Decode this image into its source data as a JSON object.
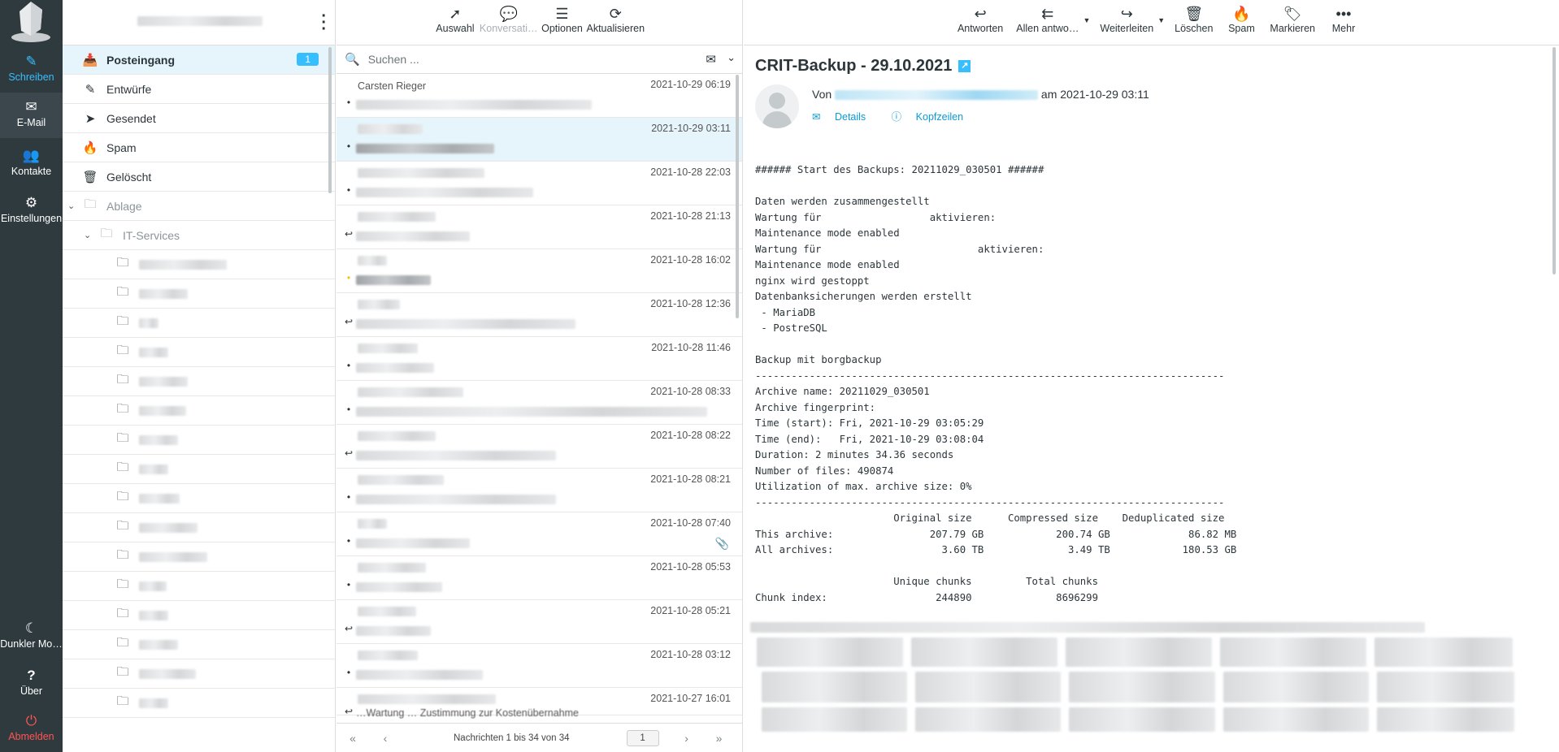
{
  "taskmenu": {
    "compose": "Schreiben",
    "mail": "E-Mail",
    "contacts": "Kontakte",
    "settings": "Einstellungen",
    "darkmode": "Dunkler Mo…",
    "about": "Über",
    "logout": "Abmelden"
  },
  "folders": {
    "inbox": "Posteingang",
    "inbox_unread": "1",
    "drafts": "Entwürfe",
    "sent": "Gesendet",
    "spam": "Spam",
    "trash": "Gelöscht",
    "archive": "Ablage",
    "itservices": "IT-Services"
  },
  "listtoolbar": {
    "select": "Auswahl",
    "threads": "Konversati…",
    "options": "Optionen",
    "refresh": "Aktualisieren"
  },
  "search": {
    "placeholder": "Suchen ..."
  },
  "messages": [
    {
      "from": "Carsten Rieger",
      "date": "2021-10-29 06:19"
    },
    {
      "date": "2021-10-29 03:11"
    },
    {
      "date": "2021-10-28 22:03"
    },
    {
      "date": "2021-10-28 21:13"
    },
    {
      "date": "2021-10-28 16:02"
    },
    {
      "date": "2021-10-28 12:36"
    },
    {
      "date": "2021-10-28 11:46"
    },
    {
      "date": "2021-10-28 08:33"
    },
    {
      "date": "2021-10-28 08:22"
    },
    {
      "date": "2021-10-28 08:21"
    },
    {
      "date": "2021-10-28 07:40"
    },
    {
      "date": "2021-10-28 05:53"
    },
    {
      "date": "2021-10-28 05:21"
    },
    {
      "date": "2021-10-28 03:12"
    },
    {
      "date": "2021-10-27 16:01",
      "subject": "…Wartung …  Zustimmung zur Kostenübernahme"
    }
  ],
  "pager": {
    "count": "Nachrichten 1 bis 34 von 34",
    "page": "1"
  },
  "msgtoolbar": {
    "reply": "Antworten",
    "replyall": "Allen antwo…",
    "forward": "Weiterleiten",
    "delete": "Löschen",
    "spam": "Spam",
    "mark": "Markieren",
    "more": "Mehr"
  },
  "message": {
    "subject": "CRIT-Backup - 29.10.2021",
    "from_label": "Von",
    "date_text": "am 2021-10-29 03:11",
    "details": "Details",
    "headers": "Kopfzeilen",
    "body": [
      "###### Start des Backups: 20211029_030501 ######",
      "",
      "Daten werden zusammengestellt",
      "Wartung für                  aktivieren:",
      "Maintenance mode enabled",
      "Wartung für                          aktivieren:",
      "Maintenance mode enabled",
      "nginx wird gestoppt",
      "Datenbanksicherungen werden erstellt",
      " - MariaDB",
      " - PostreSQL",
      "",
      "Backup mit borgbackup",
      "------------------------------------------------------------------------------",
      "Archive name: 20211029_030501",
      "Archive fingerprint:",
      "Time (start): Fri, 2021-10-29 03:05:29",
      "Time (end):   Fri, 2021-10-29 03:08:04",
      "Duration: 2 minutes 34.36 seconds",
      "Number of files: 490874",
      "Utilization of max. archive size: 0%",
      "------------------------------------------------------------------------------",
      "                       Original size      Compressed size    Deduplicated size",
      "This archive:                207.79 GB            200.74 GB             86.82 MB",
      "All archives:                  3.60 TB              3.49 TB            180.53 GB",
      "",
      "                       Unique chunks         Total chunks",
      "Chunk index:                  244890              8696299"
    ]
  }
}
